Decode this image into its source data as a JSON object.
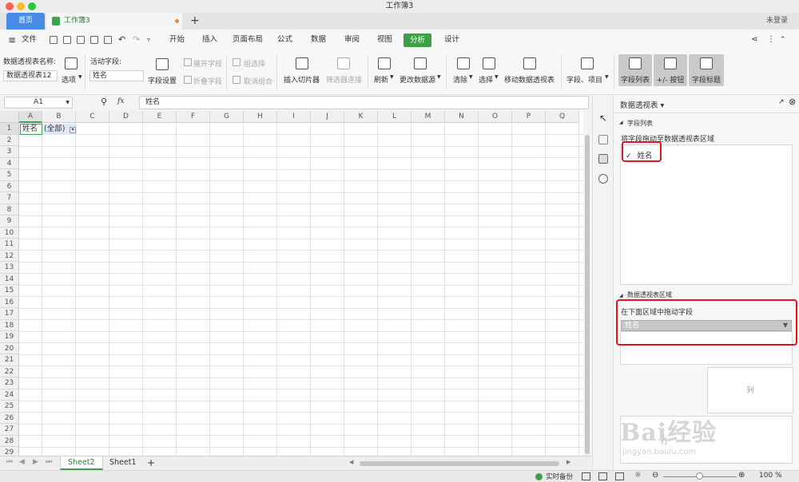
{
  "window": {
    "title": "工作簿3"
  },
  "tabs": {
    "home": "首页",
    "doc": "工作簿3",
    "plus": "+",
    "login": "未登录"
  },
  "menu": {
    "file": "文件",
    "items": [
      "开始",
      "插入",
      "页面布局",
      "公式",
      "数据",
      "审阅",
      "视图",
      "分析",
      "设计"
    ],
    "active_index": 7
  },
  "ribbon": {
    "pt_name_label": "数据透视表名称:",
    "pt_name_value": "数据透视表12",
    "options": "选项",
    "active_field_label": "活动字段:",
    "active_field_value": "姓名",
    "field_settings": "字段设置",
    "expand_field": "展开字段",
    "collapse_field": "折叠字段",
    "group_selection": "组选择",
    "ungroup": "取消组合",
    "insert_slicer": "插入切片器",
    "filter_connections": "筛选器连接",
    "refresh": "刷新",
    "change_source": "更改数据源",
    "clear": "清除",
    "select": "选择",
    "move_pivot": "移动数据透视表",
    "fields_items": "字段、项目",
    "field_list": "字段列表",
    "plus_minus": "+/- 按钮",
    "field_headers": "字段标题"
  },
  "formula_bar": {
    "cell_ref": "A1",
    "fx": "fx",
    "content": "姓名"
  },
  "grid": {
    "columns": [
      "A",
      "B",
      "C",
      "D",
      "E",
      "F",
      "G",
      "H",
      "I",
      "J",
      "K",
      "L",
      "M",
      "N",
      "O",
      "P",
      "Q"
    ],
    "rows": [
      "1",
      "2",
      "3",
      "4",
      "5",
      "6",
      "7",
      "8",
      "9",
      "10",
      "11",
      "12",
      "13",
      "14",
      "15",
      "16",
      "17",
      "18",
      "19",
      "20",
      "21",
      "22",
      "23",
      "24",
      "25",
      "26",
      "27",
      "28",
      "29"
    ],
    "A1": "姓名",
    "B1": "(全部)"
  },
  "sheets": {
    "tabs": [
      "Sheet2",
      "Sheet1"
    ],
    "active": "Sheet2",
    "add": "+"
  },
  "panel": {
    "title": "数据透视表",
    "field_list_section": "字段列表",
    "drag_hint": "将字段拖动至数据透视表区域",
    "field_item": "姓名",
    "area_section": "数据透视表区域",
    "area_hint": "在下面区域中拖动字段",
    "filter_value": "姓名",
    "columns_label": "列",
    "rows_label": "行"
  },
  "status": {
    "backup": "实时备份",
    "zoom": "100 %"
  },
  "watermark": {
    "text": "Bai经验",
    "url": "jingyan.baidu.com"
  }
}
